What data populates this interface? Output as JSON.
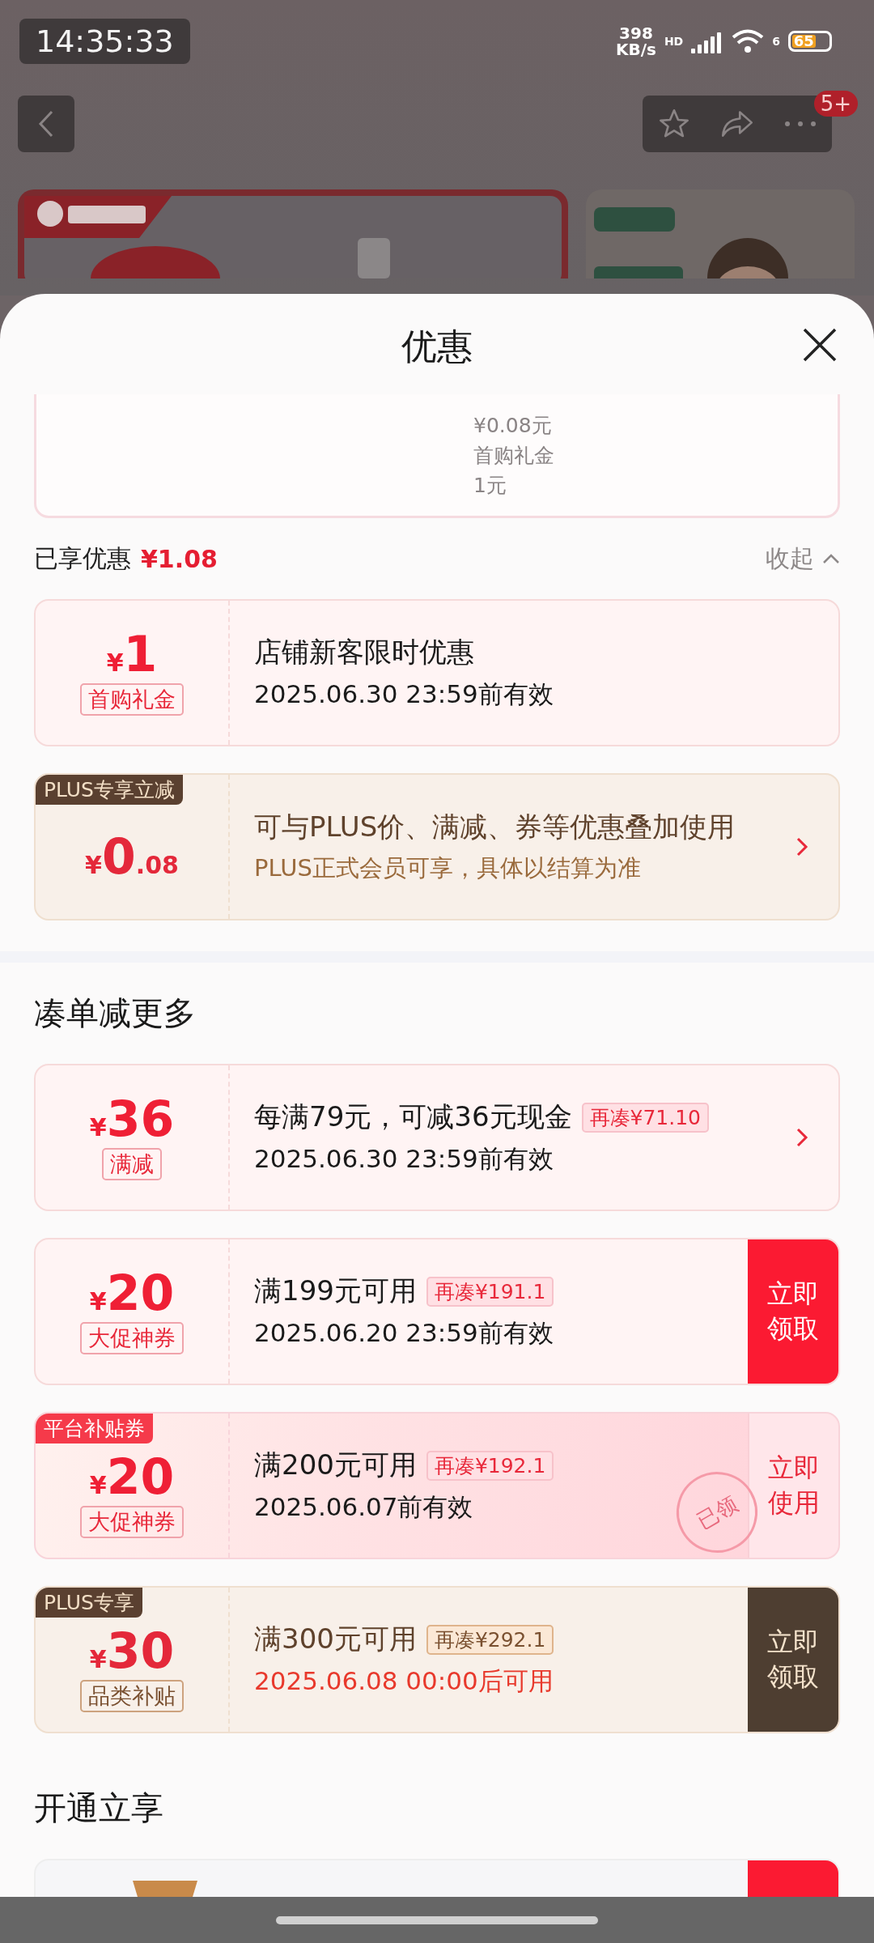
{
  "status_bar": {
    "time": "14:35:33",
    "speed": "398",
    "speed_unit": "KB/s",
    "network_label": "HD",
    "wifi_label": "6",
    "battery": "65"
  },
  "nav": {
    "badge": "5+"
  },
  "sheet": {
    "title": "优惠",
    "top_card_lines": [
      "¥0.08元",
      "首购礼金",
      "1元"
    ],
    "summary": {
      "label": "已享优惠",
      "amount": "¥1.08",
      "toggle": "收起",
      "expanded": true
    },
    "applied": [
      {
        "kind": "shop",
        "symbol": "¥",
        "amount": "1",
        "tag": "首购礼金",
        "title": "店铺新客限时优惠",
        "subtitle": "2025.06.30 23:59前有效",
        "not_yet_valid": false,
        "action": {
          "kind": "none"
        }
      },
      {
        "kind": "plus",
        "corner": "PLUS专享立减",
        "symbol": "¥",
        "amount": "0",
        "decimals": ".08",
        "title": "可与PLUS价、满减、券等优惠叠加使用",
        "subtitle": "PLUS正式会员可享，具体以结算为准",
        "not_yet_valid": false,
        "action": {
          "kind": "arrow"
        }
      }
    ],
    "sections": [
      {
        "title": "凑单减更多",
        "coupons": [
          {
            "kind": "shop",
            "symbol": "¥",
            "amount": "36",
            "tag": "满减",
            "title": "每满79元，可减36元现金",
            "extra": "再凑¥71.10",
            "subtitle": "2025.06.30 23:59前有效",
            "not_yet_valid": false,
            "action": {
              "kind": "arrow"
            }
          },
          {
            "kind": "shop",
            "symbol": "¥",
            "amount": "20",
            "tag": "大促神券",
            "title": "满199元可用",
            "extra": "再凑¥191.1",
            "subtitle": "2025.06.20 23:59前有效",
            "not_yet_valid": false,
            "action": {
              "kind": "button",
              "label": "立即领取"
            }
          },
          {
            "kind": "platform",
            "corner": "平台补贴券",
            "symbol": "¥",
            "amount": "20",
            "tag": "大促神券",
            "title": "满200元可用",
            "extra": "再凑¥192.1",
            "subtitle": "2025.06.07前有效",
            "not_yet_valid": false,
            "stamp": "已领",
            "action": {
              "kind": "button",
              "label": "立即使用"
            }
          },
          {
            "kind": "plus",
            "corner": "PLUS专享",
            "symbol": "¥",
            "amount": "30",
            "tag": "品类补贴",
            "title": "满300元可用",
            "extra": "再凑¥292.1",
            "subtitle": "2025.06.08 00:00后可用",
            "not_yet_valid": true,
            "action": {
              "kind": "button",
              "label": "立即领取"
            }
          }
        ]
      },
      {
        "title": "开通立享"
      }
    ]
  }
}
